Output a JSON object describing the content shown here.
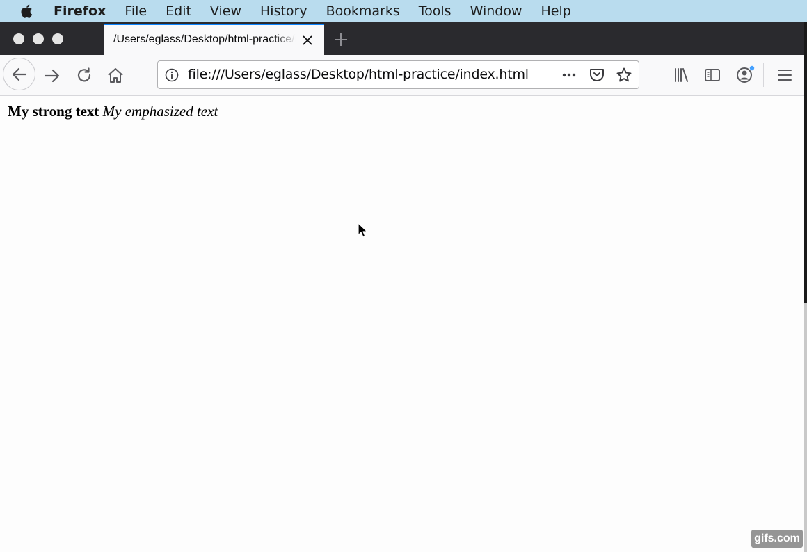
{
  "menubar": {
    "app": "Firefox",
    "items": [
      "File",
      "Edit",
      "View",
      "History",
      "Bookmarks",
      "Tools",
      "Window",
      "Help"
    ]
  },
  "tab": {
    "title": "/Users/eglass/Desktop/html-practice/index.html"
  },
  "urlbar": {
    "url": "file:///Users/eglass/Desktop/html-practice/index.html"
  },
  "page": {
    "strong_text": "My strong text",
    "em_text": "My emphasized text"
  },
  "watermark": "gifs.com",
  "icons": {
    "apple": "apple-logo-icon",
    "back": "back-arrow-icon",
    "forward": "forward-arrow-icon",
    "reload": "reload-icon",
    "home": "home-icon",
    "info": "info-icon",
    "more": "page-actions-icon",
    "pocket": "pocket-icon",
    "bookmark": "star-icon",
    "library": "library-icon",
    "sidebar": "sidebar-icon",
    "account": "account-icon",
    "menu": "hamburger-menu-icon"
  },
  "colors": {
    "menubar": "#b9dcee",
    "tabstrip": "#2a2a2e",
    "tab_accent": "#0a84ff",
    "toolbar": "#f9f9fa"
  }
}
